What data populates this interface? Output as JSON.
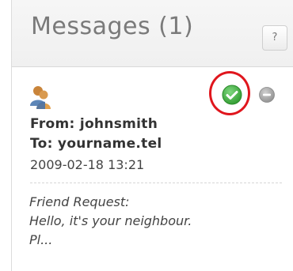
{
  "header": {
    "title": "Messages (1)",
    "help_label": "?"
  },
  "message": {
    "icon": "contact-people-icon",
    "from": "From: johnsmith",
    "to": "To: yourname.tel",
    "date": "2009-02-18 13:21",
    "body_lines": [
      "Friend Request:",
      "Hello, it's your neighbour.",
      "Pl..."
    ],
    "actions": {
      "accept_icon": "check-icon",
      "decline_icon": "minus-icon"
    }
  },
  "colors": {
    "accept_green": "#3eac3e",
    "decline_gray": "#9a9a9a",
    "highlight_red": "#e0161d",
    "title_gray": "#7a7a7a"
  }
}
